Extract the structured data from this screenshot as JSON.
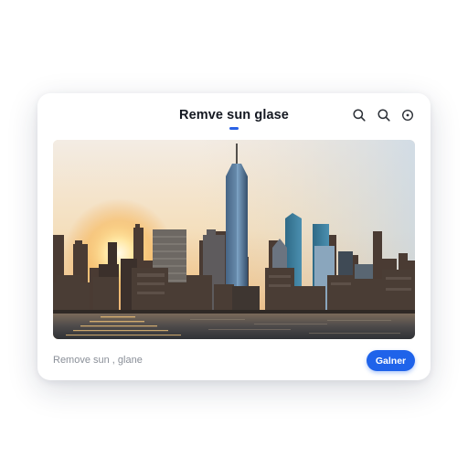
{
  "dialog": {
    "title": "Remve sun glase",
    "toolbar_icons": [
      "search-icon",
      "zoom-icon",
      "settings-icon"
    ],
    "image_icon": "city-skyline-sunset-photo",
    "caption": "Remove sun ,  glane",
    "action_label": "Galner"
  },
  "colors": {
    "accent": "#1f63ea",
    "title_text": "#141821",
    "caption_text": "#8a8f98",
    "background": "#ffffff"
  }
}
